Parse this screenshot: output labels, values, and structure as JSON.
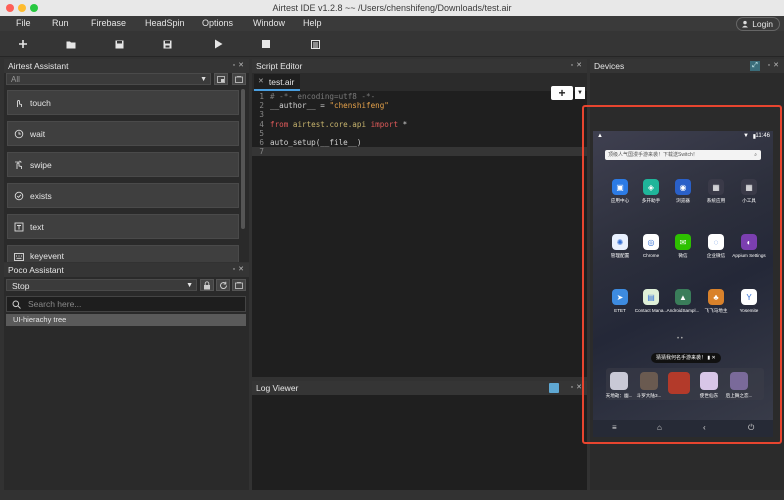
{
  "window": {
    "title": "Airtest IDE v1.2.8 ~~ /Users/chenshifeng/Downloads/test.air"
  },
  "menu": {
    "items": [
      "File",
      "Run",
      "Firebase",
      "HeadSpin",
      "Options",
      "Window",
      "Help"
    ],
    "login_label": "Login"
  },
  "toolbar": {
    "icons": [
      "new-file-icon",
      "open-folder-icon",
      "save-icon",
      "save-as-icon",
      "run-icon",
      "stop-icon",
      "report-icon"
    ]
  },
  "airtest_assistant": {
    "title": "Airtest Assistant",
    "filter_value": "All",
    "buttons": [
      "touch",
      "wait",
      "swipe",
      "exists",
      "text",
      "keyevent"
    ]
  },
  "poco_assistant": {
    "title": "Poco Assistant",
    "mode_value": "Stop",
    "search_placeholder": "Search here...",
    "tree_item": "UI-hierachy tree"
  },
  "script_editor": {
    "title": "Script Editor",
    "tab_label": "test.air",
    "lines": {
      "l1": "# -*- encoding=utf8 -*-",
      "l2a": "__author__ = ",
      "l2b": "\"chenshifeng\"",
      "l4a": "from",
      "l4b": " airtest.core.api ",
      "l4c": "import",
      "l4d": " *",
      "l6": "auto_setup(__file__)"
    },
    "line_numbers": [
      "1",
      "2",
      "3",
      "4",
      "5",
      "6",
      "7"
    ]
  },
  "log_viewer": {
    "title": "Log Viewer"
  },
  "devices": {
    "title": "Devices",
    "phone": {
      "time": "11:46",
      "search_placeholder": "顶级人气国漫手游来袭！下载送Switch！",
      "apps": [
        {
          "label": "应用中心",
          "color": "#2c7be5",
          "glyph": "▣"
        },
        {
          "label": "多开助手",
          "color": "#1fb59a",
          "glyph": "◈"
        },
        {
          "label": "浏览器",
          "color": "#2a60c8",
          "glyph": "◉"
        },
        {
          "label": "系统应用",
          "color": "#3a3a48",
          "glyph": "▦"
        },
        {
          "label": "小工具",
          "color": "#3a3a48",
          "glyph": "▦"
        },
        {
          "label": "管理配置",
          "color": "#e9f1ff",
          "glyph": "✺"
        },
        {
          "label": "Chrome",
          "color": "#ffffff",
          "glyph": "◎"
        },
        {
          "label": "微信",
          "color": "#2dc100",
          "glyph": "✉"
        },
        {
          "label": "企业微信",
          "color": "#ffffff",
          "glyph": "◌"
        },
        {
          "label": "Appium Settings",
          "color": "#7b3fb0",
          "glyph": "◐"
        },
        {
          "label": "ETET",
          "color": "#3d8be0",
          "glyph": "➤"
        },
        {
          "label": "Contact Mana...",
          "color": "#dff0d8",
          "glyph": "▤"
        },
        {
          "label": "AndroidSampl...",
          "color": "#3a7d5a",
          "glyph": "▲"
        },
        {
          "label": "飞飞马地主",
          "color": "#d9822b",
          "glyph": "♣"
        },
        {
          "label": "Yosemite",
          "color": "#ffffff",
          "glyph": "Y"
        }
      ],
      "toast": "猜猜我何名手游来袭！",
      "dock": [
        {
          "label": "天地劫：幽...",
          "color": "#c9c9d6"
        },
        {
          "label": "斗罗大陆3...",
          "color": "#6a5a50"
        },
        {
          "label": "",
          "color": "#b33a2a"
        },
        {
          "label": "使世仙东",
          "color": "#d8c6e8"
        },
        {
          "label": "后上舞之恋...",
          "color": "#7a6a9a"
        }
      ],
      "nav": [
        "menu-icon",
        "home-icon",
        "back-icon",
        "power-icon"
      ]
    }
  }
}
